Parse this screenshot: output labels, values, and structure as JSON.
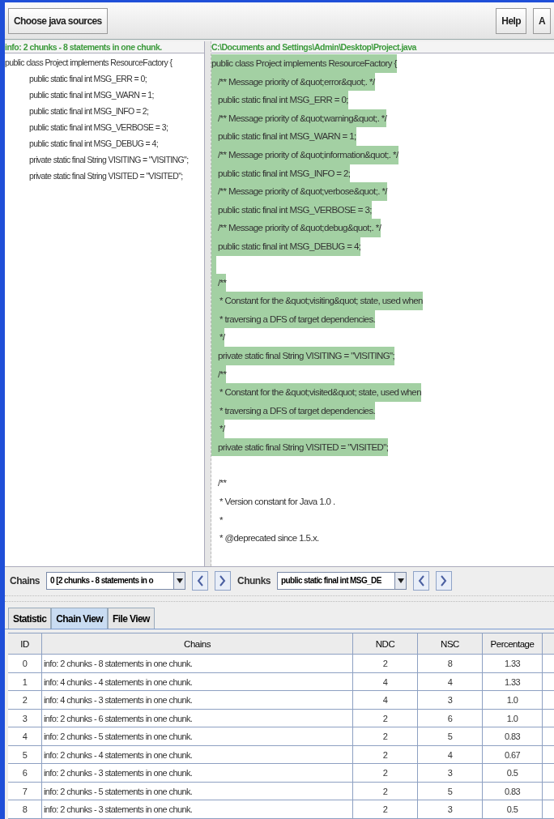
{
  "toolbar": {
    "left_buttons": [
      "Choose java sources"
    ],
    "right_buttons": [
      "Help",
      "A"
    ]
  },
  "left_pane": {
    "header": "info: 2 chunks - 8 statements in one chunk.",
    "lines": [
      {
        "text": "public class Project implements ResourceFactory {",
        "kind": "plain"
      },
      {
        "text": "public static final int MSG_ERR = 0;",
        "kind": "indented"
      },
      {
        "text": "public static final int MSG_WARN = 1;",
        "kind": "indented"
      },
      {
        "text": "public static final int MSG_INFO = 2;",
        "kind": "indented"
      },
      {
        "text": "public static final int MSG_VERBOSE = 3;",
        "kind": "indented"
      },
      {
        "text": "public static final int MSG_DEBUG = 4;",
        "kind": "indented"
      },
      {
        "text": "private static final String VISITING = \"VISITING\";",
        "kind": "indented"
      },
      {
        "text": "private static final String VISITED = \"VISITED\";",
        "kind": "indented"
      }
    ]
  },
  "right_pane": {
    "header": "C:\\Documents and Settings\\Admin\\Desktop\\Project.java",
    "lines": [
      {
        "text": "public class Project implements ResourceFactory {",
        "kind": "plain",
        "highlighted": true
      },
      {
        "text": "/** Message priority of &quot;error&quot;. */",
        "kind": "indented",
        "highlighted": true
      },
      {
        "text": "public static final int MSG_ERR = 0;",
        "kind": "indented",
        "highlighted": true
      },
      {
        "text": "/** Message priority of &quot;warning&quot;. */",
        "kind": "indented",
        "highlighted": true
      },
      {
        "text": "public static final int MSG_WARN = 1;",
        "kind": "indented",
        "highlighted": true
      },
      {
        "text": "/** Message priority of &quot;information&quot;. */",
        "kind": "indented",
        "highlighted": true
      },
      {
        "text": "public static final int MSG_INFO = 2;",
        "kind": "indented",
        "highlighted": true
      },
      {
        "text": "/** Message priority of &quot;verbose&quot;. */",
        "kind": "indented",
        "highlighted": true
      },
      {
        "text": "public static final int MSG_VERBOSE = 3;",
        "kind": "indented",
        "highlighted": true
      },
      {
        "text": "/** Message priority of &quot;debug&quot;. */",
        "kind": "indented",
        "highlighted": true
      },
      {
        "text": "public static final int MSG_DEBUG = 4;",
        "kind": "indented",
        "highlighted": true
      },
      {
        "kind": "gap",
        "highlighted": true
      },
      {
        "text": "/**",
        "kind": "indented",
        "highlighted": true
      },
      {
        "text": "* Constant for the &quot;visiting&quot; state, used when",
        "kind": "comment",
        "highlighted": true
      },
      {
        "text": "* traversing a DFS of target dependencies.",
        "kind": "comment",
        "highlighted": true
      },
      {
        "text": "*/",
        "kind": "comment",
        "highlighted": true
      },
      {
        "text": "private static final String VISITING = \"VISITING\";",
        "kind": "indented",
        "highlighted": true
      },
      {
        "text": "/**",
        "kind": "indented",
        "highlighted": true
      },
      {
        "text": "* Constant for the &quot;visited&quot; state, used when",
        "kind": "comment",
        "highlighted": true
      },
      {
        "text": "* traversing a DFS of target dependencies.",
        "kind": "comment",
        "highlighted": true
      },
      {
        "text": "*/",
        "kind": "comment",
        "highlighted": true
      },
      {
        "text": "private static final String VISITED = \"VISITED\";",
        "kind": "indented",
        "highlighted": true
      },
      {
        "kind": "gap"
      },
      {
        "text": "/**",
        "kind": "indented",
        "highlighted": false
      },
      {
        "text": "* Version constant for Java 1.0 .",
        "kind": "comment",
        "highlighted": false
      },
      {
        "text": "*",
        "kind": "comment",
        "highlighted": false
      },
      {
        "text": "* @deprecated since 1.5.x.",
        "kind": "comment",
        "highlighted": false
      }
    ]
  },
  "chains_control": {
    "label": "Chains",
    "value": "0 [2 chunks - 8 statements in o"
  },
  "chunks_control": {
    "label": "Chunks",
    "value": "public static final int MSG_DE"
  },
  "tabs": [
    {
      "label": "Statistic",
      "selected": false
    },
    {
      "label": "Chain View",
      "selected": true
    },
    {
      "label": "File View",
      "selected": false
    }
  ],
  "table": {
    "columns": [
      "ID",
      "Chains",
      "NDC",
      "NSC",
      "Percentage"
    ],
    "rows": [
      [
        "0",
        "info: 2 chunks - 8 statements in one chunk.",
        "2",
        "8",
        "1.33"
      ],
      [
        "1",
        "info: 4 chunks - 4 statements in one chunk.",
        "4",
        "4",
        "1.33"
      ],
      [
        "2",
        "info: 4 chunks - 3 statements in one chunk.",
        "4",
        "3",
        "1.0"
      ],
      [
        "3",
        "info: 2 chunks - 6 statements in one chunk.",
        "2",
        "6",
        "1.0"
      ],
      [
        "4",
        "info: 2 chunks - 5 statements in one chunk.",
        "2",
        "5",
        "0.83"
      ],
      [
        "5",
        "info: 2 chunks - 4 statements in one chunk.",
        "2",
        "4",
        "0.67"
      ],
      [
        "6",
        "info: 2 chunks - 3 statements in one chunk.",
        "2",
        "3",
        "0.5"
      ],
      [
        "7",
        "info: 2 chunks - 5 statements in one chunk.",
        "2",
        "5",
        "0.83"
      ],
      [
        "8",
        "info: 2 chunks - 3 statements in one chunk.",
        "2",
        "3",
        "0.5"
      ]
    ]
  }
}
